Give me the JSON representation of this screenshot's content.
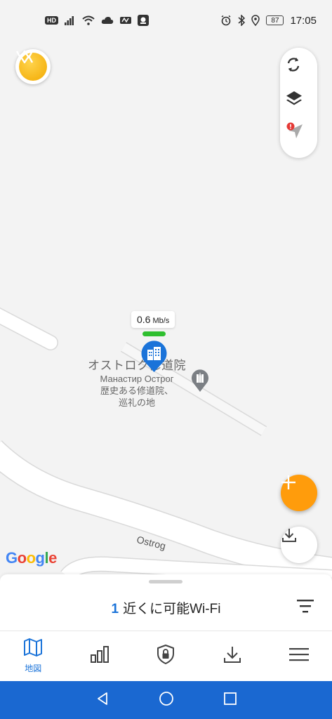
{
  "status_bar": {
    "hd": "HD",
    "battery": "87",
    "time": "17:05"
  },
  "map": {
    "speed_value": "0.6",
    "speed_unit": "Mb/s",
    "place_title": "オストロク修道院",
    "place_lines": [
      "Манастир Острог",
      "歴史ある修道院、",
      "巡礼の地"
    ],
    "road_label": "Ostrog",
    "google_logo": "Google",
    "colors": {
      "google_blue": "#4285F4",
      "google_red": "#EA4335",
      "google_yellow": "#FBBC05",
      "google_green": "#34A853",
      "speed_green": "#2fbf2f",
      "pin_blue": "#1a73d9",
      "fab_orange": "#ff9c0c"
    }
  },
  "map_controls": {
    "icons": [
      "refresh-icon",
      "layers-icon",
      "location-arrow-icon"
    ]
  },
  "sheet": {
    "count": "1",
    "title": "近くに可能Wi-Fi"
  },
  "tabs": [
    {
      "name": "map",
      "label": "地図",
      "icon": "map-icon",
      "active": true
    },
    {
      "name": "stats",
      "label": "",
      "icon": "bar-chart-icon",
      "active": false
    },
    {
      "name": "security",
      "label": "",
      "icon": "shield-lock-icon",
      "active": false
    },
    {
      "name": "downloads",
      "label": "",
      "icon": "download-icon",
      "active": false
    },
    {
      "name": "menu",
      "label": "",
      "icon": "menu-icon",
      "active": false
    }
  ],
  "navbar": {
    "icons": [
      "back-icon",
      "home-icon",
      "recents-icon"
    ]
  }
}
